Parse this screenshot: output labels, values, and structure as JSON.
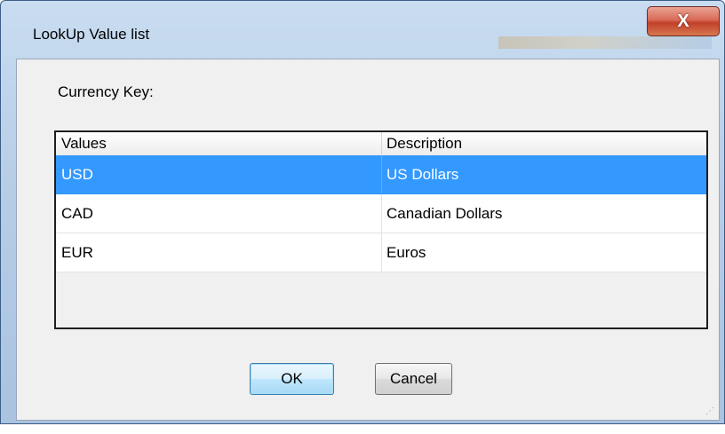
{
  "window": {
    "title": "LookUp Value list",
    "close_glyph": "X"
  },
  "dialog": {
    "field_label": "Currency Key:",
    "columns": [
      "Values",
      "Description"
    ],
    "rows": [
      {
        "value": "USD",
        "description": "US Dollars",
        "selected": true
      },
      {
        "value": "CAD",
        "description": "Canadian Dollars",
        "selected": false
      },
      {
        "value": "EUR",
        "description": "Euros",
        "selected": false
      }
    ],
    "ok_label": "OK",
    "cancel_label": "Cancel"
  },
  "colors": {
    "selection": "#3399ff",
    "title_bar": "#b6cde6",
    "close_button": "#c2402a"
  },
  "icons": [
    "close-icon",
    "resize-grip-icon"
  ]
}
